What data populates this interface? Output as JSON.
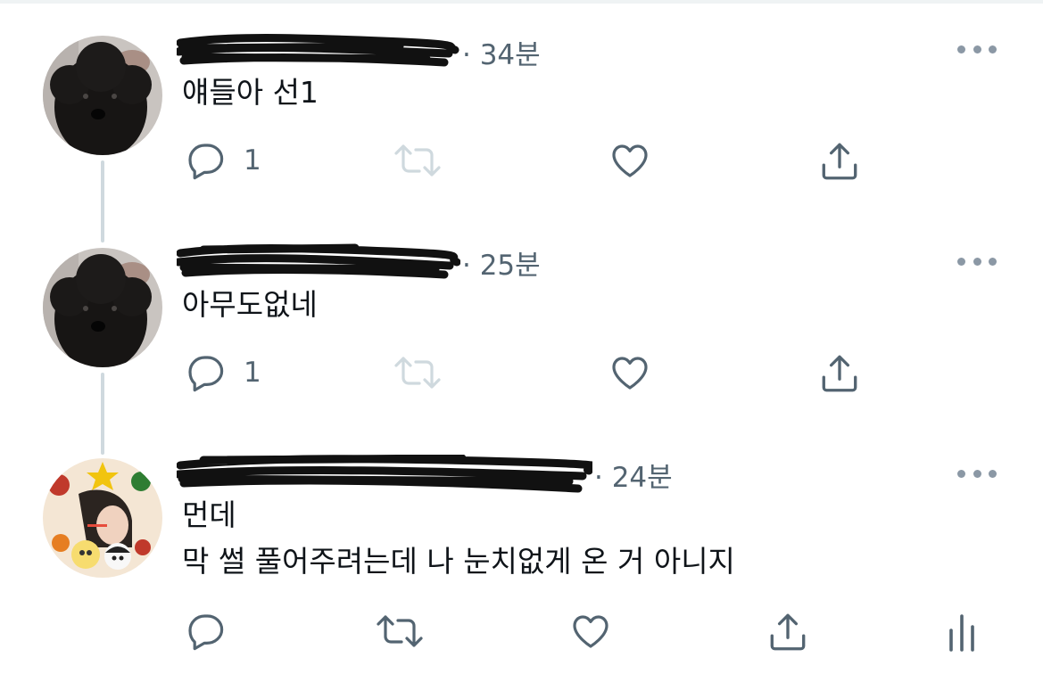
{
  "tweets": [
    {
      "time": "· 34분",
      "lines": [
        "얘들아 선1"
      ],
      "reply_count": "1",
      "avatar": "black-poodle-photo"
    },
    {
      "time": "· 25분",
      "lines": [
        "아무도없네"
      ],
      "reply_count": "1",
      "avatar": "black-poodle-photo"
    },
    {
      "time": "· 24분",
      "lines": [
        "먼데",
        "막 썰 풀어주려는데 나 눈치없게 온 거 아니지"
      ],
      "reply_count": "",
      "avatar": "illustrated-christmas-avatar"
    }
  ],
  "icons": {
    "reply": "reply-icon",
    "retweet": "retweet-icon",
    "like": "like-icon",
    "share": "share-icon",
    "analytics": "analytics-icon",
    "more": "more-icon"
  },
  "colors": {
    "secondary_text": "#536471",
    "icon_gray": "#536471",
    "disabled_icon": "#cfd9de",
    "thread_line": "#cfd9de",
    "more_dots": "#8b98a5"
  }
}
